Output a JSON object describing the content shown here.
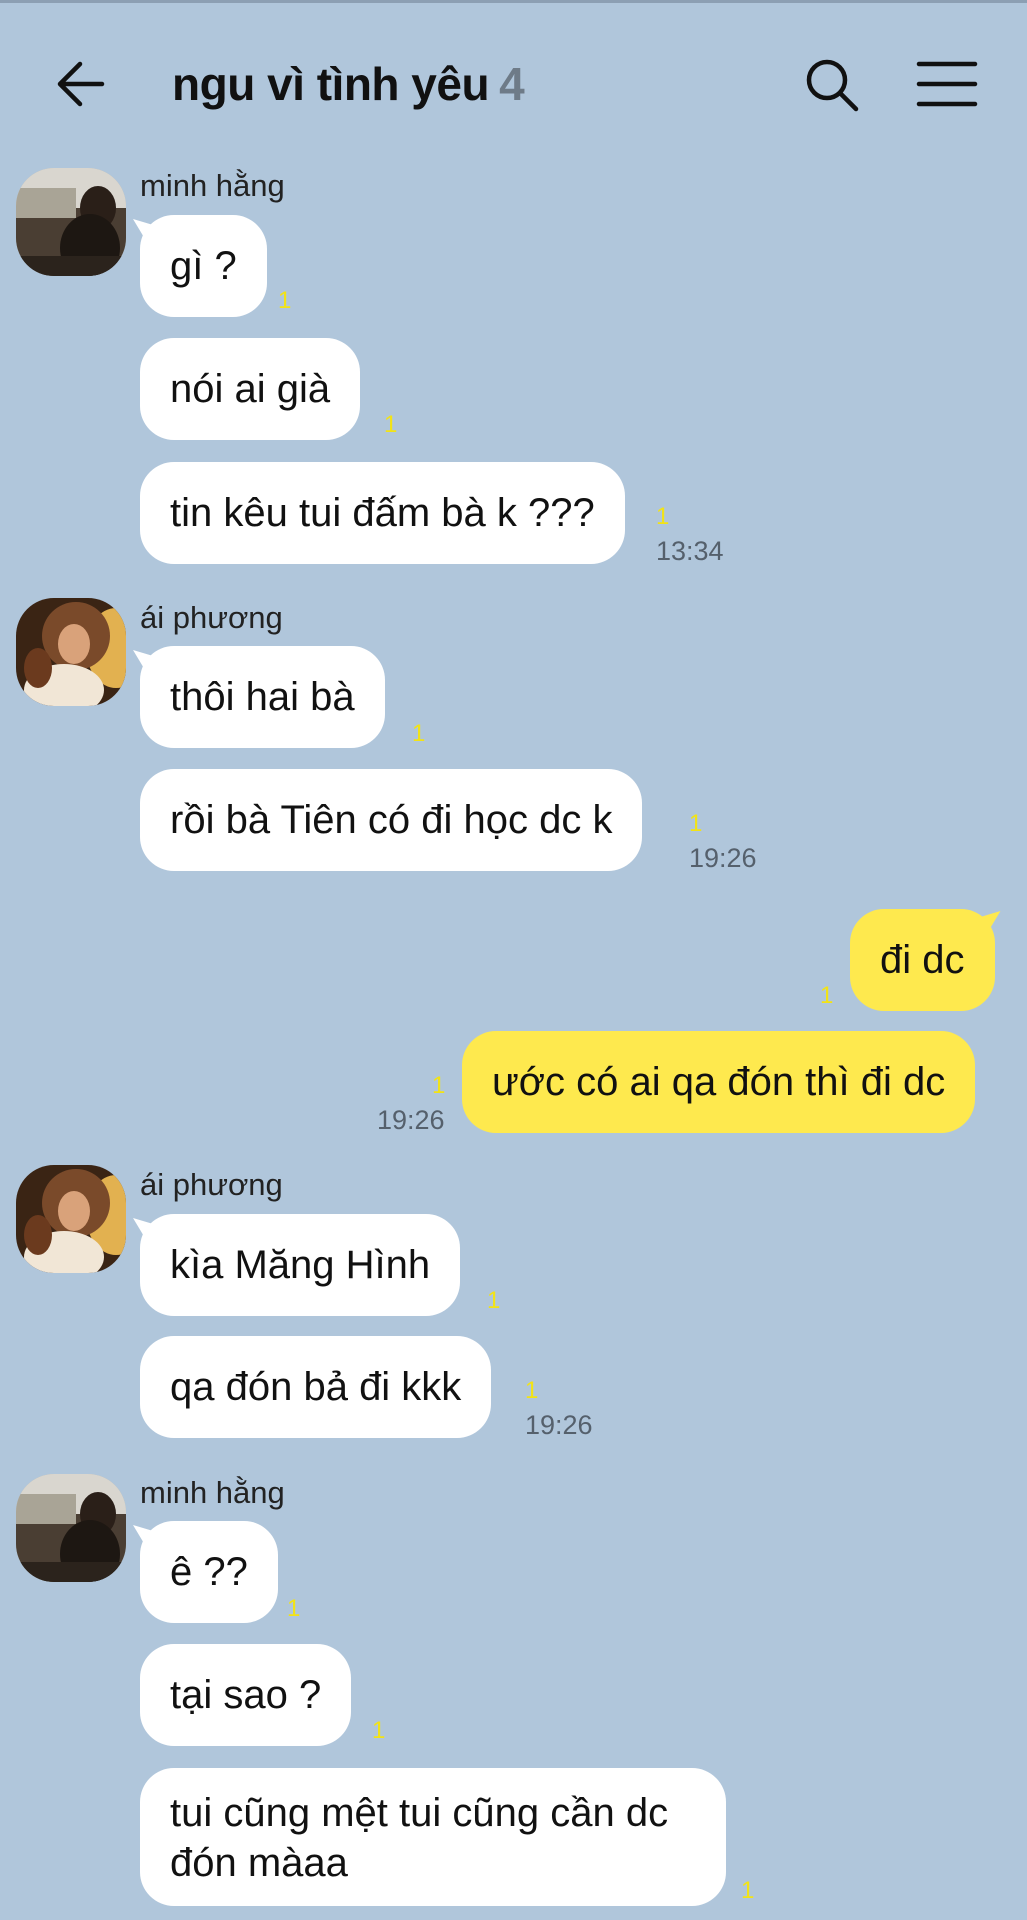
{
  "header": {
    "title": "ngu vì tình yêu",
    "member_count": "4",
    "icons": [
      "back-arrow-icon",
      "search-icon",
      "menu-icon"
    ]
  },
  "colors": {
    "background": "#b0c6db",
    "incoming_bubble": "#ffffff",
    "outgoing_bubble": "#fee94e",
    "unread_marker": "#f2e316"
  },
  "groups": [
    {
      "sender": "minh hằng",
      "messages": [
        {
          "text": "gì ?",
          "unread": "1"
        },
        {
          "text": "nói ai già",
          "unread": "1"
        },
        {
          "text": "tin kêu tui đấm bà k ???",
          "unread": "1",
          "time": "13:34"
        }
      ]
    },
    {
      "sender": "ái phương",
      "messages": [
        {
          "text": "thôi hai bà",
          "unread": "1"
        },
        {
          "text": "rồi bà Tiên có đi học dc k",
          "unread": "1",
          "time": "19:26"
        }
      ]
    },
    {
      "sender": "",
      "outgoing": true,
      "messages": [
        {
          "text": "đi dc",
          "unread": "1"
        },
        {
          "text": "ước có ai qa đón thì đi dc",
          "unread": "1",
          "time": "19:26"
        }
      ]
    },
    {
      "sender": "ái phương",
      "messages": [
        {
          "text": "kìa Măng Hình",
          "unread": "1"
        },
        {
          "text": "qa đón bả đi kkk",
          "unread": "1",
          "time": "19:26"
        }
      ]
    },
    {
      "sender": "minh hằng",
      "messages": [
        {
          "text": "ê ??",
          "unread": "1"
        },
        {
          "text": "tại sao ?",
          "unread": "1"
        },
        {
          "text": "tui cũng mệt tui cũng cần dc đón màaa",
          "unread": "1"
        }
      ]
    }
  ]
}
